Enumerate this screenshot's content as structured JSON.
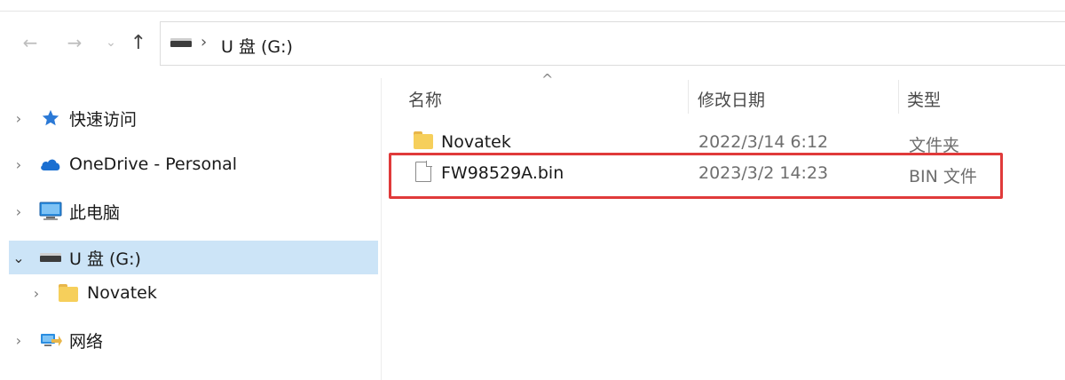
{
  "address": {
    "back_glyph": "←",
    "forward_glyph": "→",
    "recent_glyph": "⌄",
    "up_glyph": "↑",
    "separator": "›",
    "path": "U 盘 (G:)"
  },
  "sidebar": {
    "items": [
      {
        "label": "快速访问",
        "chevron": "›",
        "icon": "star-icon"
      },
      {
        "label": "OneDrive - Personal",
        "chevron": "›",
        "icon": "cloud-icon"
      },
      {
        "label": "此电脑",
        "chevron": "›",
        "icon": "computer-icon"
      },
      {
        "label": "U 盘 (G:)",
        "chevron": "⌄",
        "icon": "drive-icon",
        "selected": true
      },
      {
        "label": "Novatek",
        "chevron": "›",
        "icon": "folder-icon"
      },
      {
        "label": "网络",
        "chevron": "›",
        "icon": "network-icon"
      }
    ]
  },
  "columns": {
    "name": "名称",
    "date": "修改日期",
    "type": "类型",
    "sort_indicator": "^"
  },
  "files": [
    {
      "name": "Novatek",
      "date": "2022/3/14 6:12",
      "type": "文件夹",
      "icon": "folder-icon"
    },
    {
      "name": "FW98529A.bin",
      "date": "2023/3/2 14:23",
      "type": "BIN 文件",
      "icon": "file-icon"
    }
  ],
  "colors": {
    "selection": "#cce4f7",
    "highlight_border": "#e03a3a",
    "folder": "#f6cf5b",
    "star": "#2b79d6",
    "onedrive": "#1a6fd1"
  }
}
